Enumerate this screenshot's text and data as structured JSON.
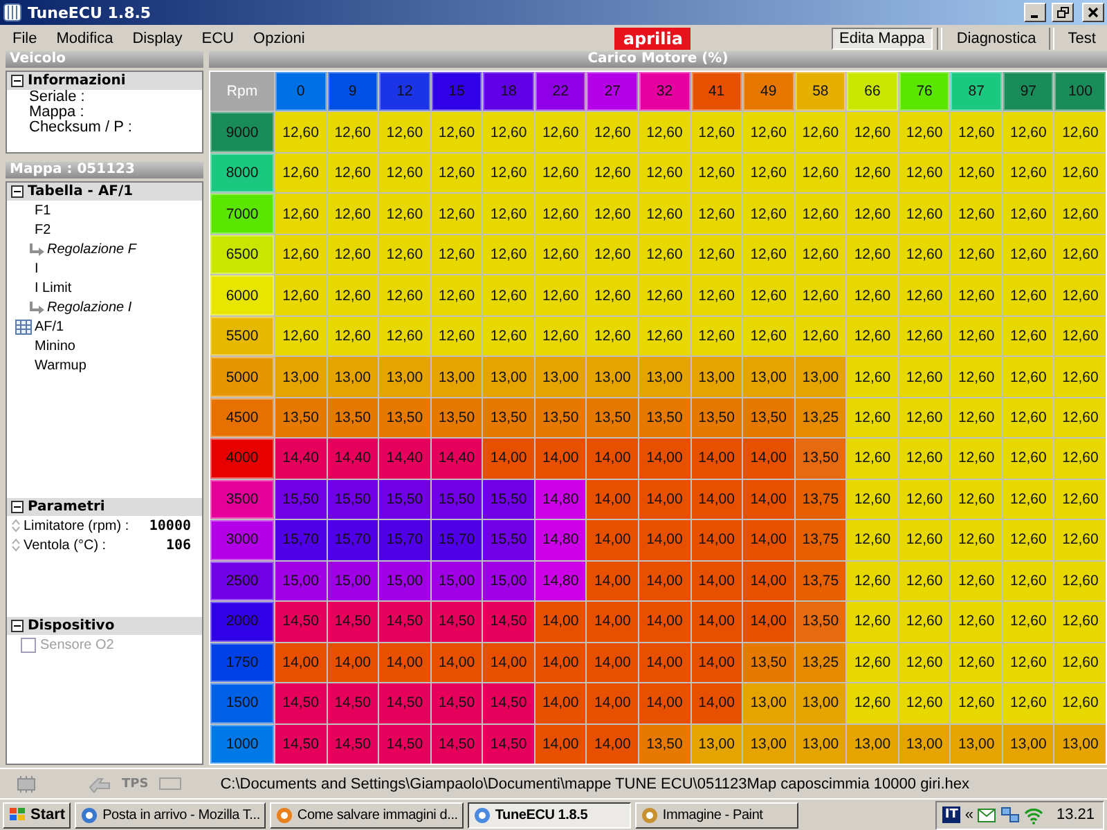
{
  "window": {
    "title": "TuneECU 1.8.5"
  },
  "menu": [
    "File",
    "Modifica",
    "Display",
    "ECU",
    "Opzioni"
  ],
  "logo": "aprilia",
  "tabs": [
    {
      "label": "Edita Mappa",
      "selected": true
    },
    {
      "label": "Diagnostica",
      "selected": false
    },
    {
      "label": "Test",
      "selected": false
    }
  ],
  "sidebar": {
    "vehicle": {
      "title": "Veicolo",
      "group": {
        "label": "Informazioni",
        "expanded": true,
        "fields": [
          "Seriale :",
          "Mappa :",
          "Checksum / P :"
        ]
      }
    },
    "map": {
      "title": "Mappa : 051123",
      "tree": {
        "label": "Tabella - AF/1",
        "expanded": true,
        "items": [
          {
            "label": "F1",
            "kind": "plain"
          },
          {
            "label": "F2",
            "kind": "plain",
            "children": [
              {
                "label": "Regolazione F",
                "kind": "sub"
              }
            ]
          },
          {
            "label": "I",
            "kind": "plain"
          },
          {
            "label": "I Limit",
            "kind": "plain",
            "children": [
              {
                "label": "Regolazione I",
                "kind": "sub"
              }
            ]
          },
          {
            "label": "AF/1",
            "kind": "table"
          },
          {
            "label": "Minino",
            "kind": "plain"
          },
          {
            "label": "Warmup",
            "kind": "plain"
          }
        ]
      }
    },
    "parameters": {
      "label": "Parametri",
      "expanded": true,
      "items": [
        {
          "label": "Limitatore (rpm) :",
          "value": "10000"
        },
        {
          "label": "Ventola (°C) :",
          "value": "106"
        }
      ]
    },
    "device": {
      "label": "Dispositivo",
      "expanded": true,
      "items": [
        {
          "label": "Sensore O2",
          "checked": false,
          "disabled": true
        }
      ]
    }
  },
  "table": {
    "title": "Carico Motore (%)",
    "corner": "Rpm",
    "columns": [
      {
        "label": "0",
        "color": "#0070e6"
      },
      {
        "label": "9",
        "color": "#0050e6"
      },
      {
        "label": "12",
        "color": "#1a34e6"
      },
      {
        "label": "15",
        "color": "#3000e6"
      },
      {
        "label": "18",
        "color": "#6000e6"
      },
      {
        "label": "22",
        "color": "#9000e6"
      },
      {
        "label": "27",
        "color": "#b400e6"
      },
      {
        "label": "32",
        "color": "#e600a0"
      },
      {
        "label": "41",
        "color": "#e65000"
      },
      {
        "label": "49",
        "color": "#e67800"
      },
      {
        "label": "58",
        "color": "#e6b000"
      },
      {
        "label": "66",
        "color": "#c8e600"
      },
      {
        "label": "76",
        "color": "#5ae600"
      },
      {
        "label": "87",
        "color": "#1ac880"
      },
      {
        "label": "97",
        "color": "#1a8c5a"
      },
      {
        "label": "100",
        "color": "#1a8c5a"
      }
    ],
    "rows": [
      {
        "rpm": "9000",
        "color": "#1a8c5a",
        "cells": [
          {
            "value": "12,60",
            "color": "#e6d800"
          },
          {
            "value": "12,60",
            "color": "#e6d800"
          },
          {
            "value": "12,60",
            "color": "#e6d800"
          },
          {
            "value": "12,60",
            "color": "#e6d800"
          },
          {
            "value": "12,60",
            "color": "#e6d800"
          },
          {
            "value": "12,60",
            "color": "#e6d800"
          },
          {
            "value": "12,60",
            "color": "#e6d800"
          },
          {
            "value": "12,60",
            "color": "#e6d800"
          },
          {
            "value": "12,60",
            "color": "#e6d800"
          },
          {
            "value": "12,60",
            "color": "#e6d800"
          },
          {
            "value": "12,60",
            "color": "#e6d800"
          },
          {
            "value": "12,60",
            "color": "#e6d800"
          },
          {
            "value": "12,60",
            "color": "#e6d800"
          },
          {
            "value": "12,60",
            "color": "#e6d800"
          },
          {
            "value": "12,60",
            "color": "#e6d800"
          },
          {
            "value": "12,60",
            "color": "#e6d800"
          }
        ]
      },
      {
        "rpm": "8000",
        "color": "#1ac880",
        "cells": [
          {
            "value": "12,60",
            "color": "#e6d800"
          },
          {
            "value": "12,60",
            "color": "#e6d800"
          },
          {
            "value": "12,60",
            "color": "#e6d800"
          },
          {
            "value": "12,60",
            "color": "#e6d800"
          },
          {
            "value": "12,60",
            "color": "#e6d800"
          },
          {
            "value": "12,60",
            "color": "#e6d800"
          },
          {
            "value": "12,60",
            "color": "#e6d800"
          },
          {
            "value": "12,60",
            "color": "#e6d800"
          },
          {
            "value": "12,60",
            "color": "#e6d800"
          },
          {
            "value": "12,60",
            "color": "#e6d800"
          },
          {
            "value": "12,60",
            "color": "#e6d800"
          },
          {
            "value": "12,60",
            "color": "#e6d800"
          },
          {
            "value": "12,60",
            "color": "#e6d800"
          },
          {
            "value": "12,60",
            "color": "#e6d800"
          },
          {
            "value": "12,60",
            "color": "#e6d800"
          },
          {
            "value": "12,60",
            "color": "#e6d800"
          }
        ]
      },
      {
        "rpm": "7000",
        "color": "#5ae600",
        "cells": [
          {
            "value": "12,60",
            "color": "#e6d800"
          },
          {
            "value": "12,60",
            "color": "#e6d800"
          },
          {
            "value": "12,60",
            "color": "#e6d800"
          },
          {
            "value": "12,60",
            "color": "#e6d800"
          },
          {
            "value": "12,60",
            "color": "#e6d800"
          },
          {
            "value": "12,60",
            "color": "#e6d800"
          },
          {
            "value": "12,60",
            "color": "#e6d800"
          },
          {
            "value": "12,60",
            "color": "#e6d800"
          },
          {
            "value": "12,60",
            "color": "#e6d800"
          },
          {
            "value": "12,60",
            "color": "#e6d800"
          },
          {
            "value": "12,60",
            "color": "#e6d800"
          },
          {
            "value": "12,60",
            "color": "#e6d800"
          },
          {
            "value": "12,60",
            "color": "#e6d800"
          },
          {
            "value": "12,60",
            "color": "#e6d800"
          },
          {
            "value": "12,60",
            "color": "#e6d800"
          },
          {
            "value": "12,60",
            "color": "#e6d800"
          }
        ]
      },
      {
        "rpm": "6500",
        "color": "#c8e600",
        "cells": [
          {
            "value": "12,60",
            "color": "#e6d800"
          },
          {
            "value": "12,60",
            "color": "#e6d800"
          },
          {
            "value": "12,60",
            "color": "#e6d800"
          },
          {
            "value": "12,60",
            "color": "#e6d800"
          },
          {
            "value": "12,60",
            "color": "#e6d800"
          },
          {
            "value": "12,60",
            "color": "#e6d800"
          },
          {
            "value": "12,60",
            "color": "#e6d800"
          },
          {
            "value": "12,60",
            "color": "#e6d800"
          },
          {
            "value": "12,60",
            "color": "#e6d800"
          },
          {
            "value": "12,60",
            "color": "#e6d800"
          },
          {
            "value": "12,60",
            "color": "#e6d800"
          },
          {
            "value": "12,60",
            "color": "#e6d800"
          },
          {
            "value": "12,60",
            "color": "#e6d800"
          },
          {
            "value": "12,60",
            "color": "#e6d800"
          },
          {
            "value": "12,60",
            "color": "#e6d800"
          },
          {
            "value": "12,60",
            "color": "#e6d800"
          }
        ]
      },
      {
        "rpm": "6000",
        "color": "#e6e600",
        "cells": [
          {
            "value": "12,60",
            "color": "#e6d800"
          },
          {
            "value": "12,60",
            "color": "#e6d800"
          },
          {
            "value": "12,60",
            "color": "#e6d800"
          },
          {
            "value": "12,60",
            "color": "#e6d800"
          },
          {
            "value": "12,60",
            "color": "#e6d800"
          },
          {
            "value": "12,60",
            "color": "#e6d800"
          },
          {
            "value": "12,60",
            "color": "#e6d800"
          },
          {
            "value": "12,60",
            "color": "#e6d800"
          },
          {
            "value": "12,60",
            "color": "#e6d800"
          },
          {
            "value": "12,60",
            "color": "#e6d800"
          },
          {
            "value": "12,60",
            "color": "#e6d800"
          },
          {
            "value": "12,60",
            "color": "#e6d800"
          },
          {
            "value": "12,60",
            "color": "#e6d800"
          },
          {
            "value": "12,60",
            "color": "#e6d800"
          },
          {
            "value": "12,60",
            "color": "#e6d800"
          },
          {
            "value": "12,60",
            "color": "#e6d800"
          }
        ]
      },
      {
        "rpm": "5500",
        "color": "#e6b800",
        "cells": [
          {
            "value": "12,60",
            "color": "#e6d800"
          },
          {
            "value": "12,60",
            "color": "#e6d800"
          },
          {
            "value": "12,60",
            "color": "#e6d800"
          },
          {
            "value": "12,60",
            "color": "#e6d800"
          },
          {
            "value": "12,60",
            "color": "#e6d800"
          },
          {
            "value": "12,60",
            "color": "#e6d800"
          },
          {
            "value": "12,60",
            "color": "#e6d800"
          },
          {
            "value": "12,60",
            "color": "#e6d800"
          },
          {
            "value": "12,60",
            "color": "#e6d800"
          },
          {
            "value": "12,60",
            "color": "#e6d800"
          },
          {
            "value": "12,60",
            "color": "#e6d800"
          },
          {
            "value": "12,60",
            "color": "#e6d800"
          },
          {
            "value": "12,60",
            "color": "#e6d800"
          },
          {
            "value": "12,60",
            "color": "#e6d800"
          },
          {
            "value": "12,60",
            "color": "#e6d800"
          },
          {
            "value": "12,60",
            "color": "#e6d800"
          }
        ]
      },
      {
        "rpm": "5000",
        "color": "#e69600",
        "cells": [
          {
            "value": "13,00",
            "color": "#e6a400"
          },
          {
            "value": "13,00",
            "color": "#e6a400"
          },
          {
            "value": "13,00",
            "color": "#e6a400"
          },
          {
            "value": "13,00",
            "color": "#e6a400"
          },
          {
            "value": "13,00",
            "color": "#e6a400"
          },
          {
            "value": "13,00",
            "color": "#e6a400"
          },
          {
            "value": "13,00",
            "color": "#e6a400"
          },
          {
            "value": "13,00",
            "color": "#e6a400"
          },
          {
            "value": "13,00",
            "color": "#e6a400"
          },
          {
            "value": "13,00",
            "color": "#e6a400"
          },
          {
            "value": "13,00",
            "color": "#e6a400"
          },
          {
            "value": "12,60",
            "color": "#e6d800"
          },
          {
            "value": "12,60",
            "color": "#e6d800"
          },
          {
            "value": "12,60",
            "color": "#e6d800"
          },
          {
            "value": "12,60",
            "color": "#e6d800"
          },
          {
            "value": "12,60",
            "color": "#e6d800"
          }
        ]
      },
      {
        "rpm": "4500",
        "color": "#e67000",
        "cells": [
          {
            "value": "13,50",
            "color": "#e67a00"
          },
          {
            "value": "13,50",
            "color": "#e67a00"
          },
          {
            "value": "13,50",
            "color": "#e67a00"
          },
          {
            "value": "13,50",
            "color": "#e67a00"
          },
          {
            "value": "13,50",
            "color": "#e67a00"
          },
          {
            "value": "13,50",
            "color": "#e67a00"
          },
          {
            "value": "13,50",
            "color": "#e67a00"
          },
          {
            "value": "13,50",
            "color": "#e67a00"
          },
          {
            "value": "13,50",
            "color": "#e67a00"
          },
          {
            "value": "13,50",
            "color": "#e67a00"
          },
          {
            "value": "13,25",
            "color": "#e68a00"
          },
          {
            "value": "12,60",
            "color": "#e6d800"
          },
          {
            "value": "12,60",
            "color": "#e6d800"
          },
          {
            "value": "12,60",
            "color": "#e6d800"
          },
          {
            "value": "12,60",
            "color": "#e6d800"
          },
          {
            "value": "12,60",
            "color": "#e6d800"
          }
        ]
      },
      {
        "rpm": "4000",
        "color": "#e60000",
        "cells": [
          {
            "value": "14,40",
            "color": "#e6005c"
          },
          {
            "value": "14,40",
            "color": "#e6005c"
          },
          {
            "value": "14,40",
            "color": "#e6005c"
          },
          {
            "value": "14,40",
            "color": "#e6005c"
          },
          {
            "value": "14,00",
            "color": "#e65000"
          },
          {
            "value": "14,00",
            "color": "#e65000"
          },
          {
            "value": "14,00",
            "color": "#e65000"
          },
          {
            "value": "14,00",
            "color": "#e65000"
          },
          {
            "value": "14,00",
            "color": "#e65000"
          },
          {
            "value": "14,00",
            "color": "#e65000"
          },
          {
            "value": "13,50",
            "color": "#e66a10"
          },
          {
            "value": "12,60",
            "color": "#e6d800"
          },
          {
            "value": "12,60",
            "color": "#e6d800"
          },
          {
            "value": "12,60",
            "color": "#e6d800"
          },
          {
            "value": "12,60",
            "color": "#e6d800"
          },
          {
            "value": "12,60",
            "color": "#e6d800"
          }
        ]
      },
      {
        "rpm": "3500",
        "color": "#e6009a",
        "cells": [
          {
            "value": "15,50",
            "color": "#7000e6"
          },
          {
            "value": "15,50",
            "color": "#7000e6"
          },
          {
            "value": "15,50",
            "color": "#7000e6"
          },
          {
            "value": "15,50",
            "color": "#7000e6"
          },
          {
            "value": "15,50",
            "color": "#7000e6"
          },
          {
            "value": "14,80",
            "color": "#cc00e6"
          },
          {
            "value": "14,00",
            "color": "#e65000"
          },
          {
            "value": "14,00",
            "color": "#e65000"
          },
          {
            "value": "14,00",
            "color": "#e65000"
          },
          {
            "value": "14,00",
            "color": "#e65000"
          },
          {
            "value": "13,75",
            "color": "#e66000"
          },
          {
            "value": "12,60",
            "color": "#e6d800"
          },
          {
            "value": "12,60",
            "color": "#e6d800"
          },
          {
            "value": "12,60",
            "color": "#e6d800"
          },
          {
            "value": "12,60",
            "color": "#e6d800"
          },
          {
            "value": "12,60",
            "color": "#e6d800"
          }
        ]
      },
      {
        "rpm": "3000",
        "color": "#b400e6",
        "cells": [
          {
            "value": "15,70",
            "color": "#5000e6"
          },
          {
            "value": "15,70",
            "color": "#5000e6"
          },
          {
            "value": "15,70",
            "color": "#5000e6"
          },
          {
            "value": "15,70",
            "color": "#5000e6"
          },
          {
            "value": "15,50",
            "color": "#7000e6"
          },
          {
            "value": "14,80",
            "color": "#cc00e6"
          },
          {
            "value": "14,00",
            "color": "#e65000"
          },
          {
            "value": "14,00",
            "color": "#e65000"
          },
          {
            "value": "14,00",
            "color": "#e65000"
          },
          {
            "value": "14,00",
            "color": "#e65000"
          },
          {
            "value": "13,75",
            "color": "#e66000"
          },
          {
            "value": "12,60",
            "color": "#e6d800"
          },
          {
            "value": "12,60",
            "color": "#e6d800"
          },
          {
            "value": "12,60",
            "color": "#e6d800"
          },
          {
            "value": "12,60",
            "color": "#e6d800"
          },
          {
            "value": "12,60",
            "color": "#e6d800"
          }
        ]
      },
      {
        "rpm": "2500",
        "color": "#7000e6",
        "cells": [
          {
            "value": "15,00",
            "color": "#a000e6"
          },
          {
            "value": "15,00",
            "color": "#a000e6"
          },
          {
            "value": "15,00",
            "color": "#a000e6"
          },
          {
            "value": "15,00",
            "color": "#a000e6"
          },
          {
            "value": "15,00",
            "color": "#a000e6"
          },
          {
            "value": "14,80",
            "color": "#cc00e6"
          },
          {
            "value": "14,00",
            "color": "#e65000"
          },
          {
            "value": "14,00",
            "color": "#e65000"
          },
          {
            "value": "14,00",
            "color": "#e65000"
          },
          {
            "value": "14,00",
            "color": "#e65000"
          },
          {
            "value": "13,75",
            "color": "#e66000"
          },
          {
            "value": "12,60",
            "color": "#e6d800"
          },
          {
            "value": "12,60",
            "color": "#e6d800"
          },
          {
            "value": "12,60",
            "color": "#e6d800"
          },
          {
            "value": "12,60",
            "color": "#e6d800"
          },
          {
            "value": "12,60",
            "color": "#e6d800"
          }
        ]
      },
      {
        "rpm": "2000",
        "color": "#3000e6",
        "cells": [
          {
            "value": "14,50",
            "color": "#e6005c"
          },
          {
            "value": "14,50",
            "color": "#e6005c"
          },
          {
            "value": "14,50",
            "color": "#e6005c"
          },
          {
            "value": "14,50",
            "color": "#e6005c"
          },
          {
            "value": "14,50",
            "color": "#e6005c"
          },
          {
            "value": "14,00",
            "color": "#e65000"
          },
          {
            "value": "14,00",
            "color": "#e65000"
          },
          {
            "value": "14,00",
            "color": "#e65000"
          },
          {
            "value": "14,00",
            "color": "#e65000"
          },
          {
            "value": "14,00",
            "color": "#e65000"
          },
          {
            "value": "13,50",
            "color": "#e66a10"
          },
          {
            "value": "12,60",
            "color": "#e6d800"
          },
          {
            "value": "12,60",
            "color": "#e6d800"
          },
          {
            "value": "12,60",
            "color": "#e6d800"
          },
          {
            "value": "12,60",
            "color": "#e6d800"
          },
          {
            "value": "12,60",
            "color": "#e6d800"
          }
        ]
      },
      {
        "rpm": "1750",
        "color": "#0040e6",
        "cells": [
          {
            "value": "14,00",
            "color": "#e65000"
          },
          {
            "value": "14,00",
            "color": "#e65000"
          },
          {
            "value": "14,00",
            "color": "#e65000"
          },
          {
            "value": "14,00",
            "color": "#e65000"
          },
          {
            "value": "14,00",
            "color": "#e65000"
          },
          {
            "value": "14,00",
            "color": "#e65000"
          },
          {
            "value": "14,00",
            "color": "#e65000"
          },
          {
            "value": "14,00",
            "color": "#e65000"
          },
          {
            "value": "14,00",
            "color": "#e65000"
          },
          {
            "value": "13,50",
            "color": "#e67a00"
          },
          {
            "value": "13,25",
            "color": "#e68a00"
          },
          {
            "value": "12,60",
            "color": "#e6d800"
          },
          {
            "value": "12,60",
            "color": "#e6d800"
          },
          {
            "value": "12,60",
            "color": "#e6d800"
          },
          {
            "value": "12,60",
            "color": "#e6d800"
          },
          {
            "value": "12,60",
            "color": "#e6d800"
          }
        ]
      },
      {
        "rpm": "1500",
        "color": "#0060e6",
        "cells": [
          {
            "value": "14,50",
            "color": "#e6005c"
          },
          {
            "value": "14,50",
            "color": "#e6005c"
          },
          {
            "value": "14,50",
            "color": "#e6005c"
          },
          {
            "value": "14,50",
            "color": "#e6005c"
          },
          {
            "value": "14,50",
            "color": "#e6005c"
          },
          {
            "value": "14,00",
            "color": "#e65000"
          },
          {
            "value": "14,00",
            "color": "#e65000"
          },
          {
            "value": "14,00",
            "color": "#e65000"
          },
          {
            "value": "14,00",
            "color": "#e65000"
          },
          {
            "value": "13,00",
            "color": "#e6a400"
          },
          {
            "value": "13,00",
            "color": "#e6a400"
          },
          {
            "value": "12,60",
            "color": "#e6d800"
          },
          {
            "value": "12,60",
            "color": "#e6d800"
          },
          {
            "value": "12,60",
            "color": "#e6d800"
          },
          {
            "value": "12,60",
            "color": "#e6d800"
          },
          {
            "value": "12,60",
            "color": "#e6d800"
          }
        ]
      },
      {
        "rpm": "1000",
        "color": "#0078e6",
        "cells": [
          {
            "value": "14,50",
            "color": "#e6005c"
          },
          {
            "value": "14,50",
            "color": "#e6005c"
          },
          {
            "value": "14,50",
            "color": "#e6005c"
          },
          {
            "value": "14,50",
            "color": "#e6005c"
          },
          {
            "value": "14,50",
            "color": "#e6005c"
          },
          {
            "value": "14,00",
            "color": "#e65000"
          },
          {
            "value": "14,00",
            "color": "#e65000"
          },
          {
            "value": "13,50",
            "color": "#e67a00"
          },
          {
            "value": "13,00",
            "color": "#e6a400"
          },
          {
            "value": "13,00",
            "color": "#e6a400"
          },
          {
            "value": "13,00",
            "color": "#e6a400"
          },
          {
            "value": "13,00",
            "color": "#e6a400"
          },
          {
            "value": "13,00",
            "color": "#e6a400"
          },
          {
            "value": "13,00",
            "color": "#e6a400"
          },
          {
            "value": "13,00",
            "color": "#e6a400"
          },
          {
            "value": "13,00",
            "color": "#e6a400"
          }
        ]
      }
    ]
  },
  "status_bar": {
    "tps_label": "TPS",
    "path": "C:\\Documents and Settings\\Giampaolo\\Documenti\\mappe TUNE ECU\\051123Map  caposcimmia 10000 giri.hex"
  },
  "taskbar": {
    "start": "Start",
    "items": [
      {
        "label": "Posta in arrivo - Mozilla T...",
        "selected": false
      },
      {
        "label": "Come salvare immagini d...",
        "selected": false
      },
      {
        "label": "TuneECU 1.8.5",
        "selected": true
      },
      {
        "label": "Immagine - Paint",
        "selected": false
      }
    ],
    "tray": {
      "language": "IT",
      "expand": "«",
      "clock": "13.21"
    }
  }
}
